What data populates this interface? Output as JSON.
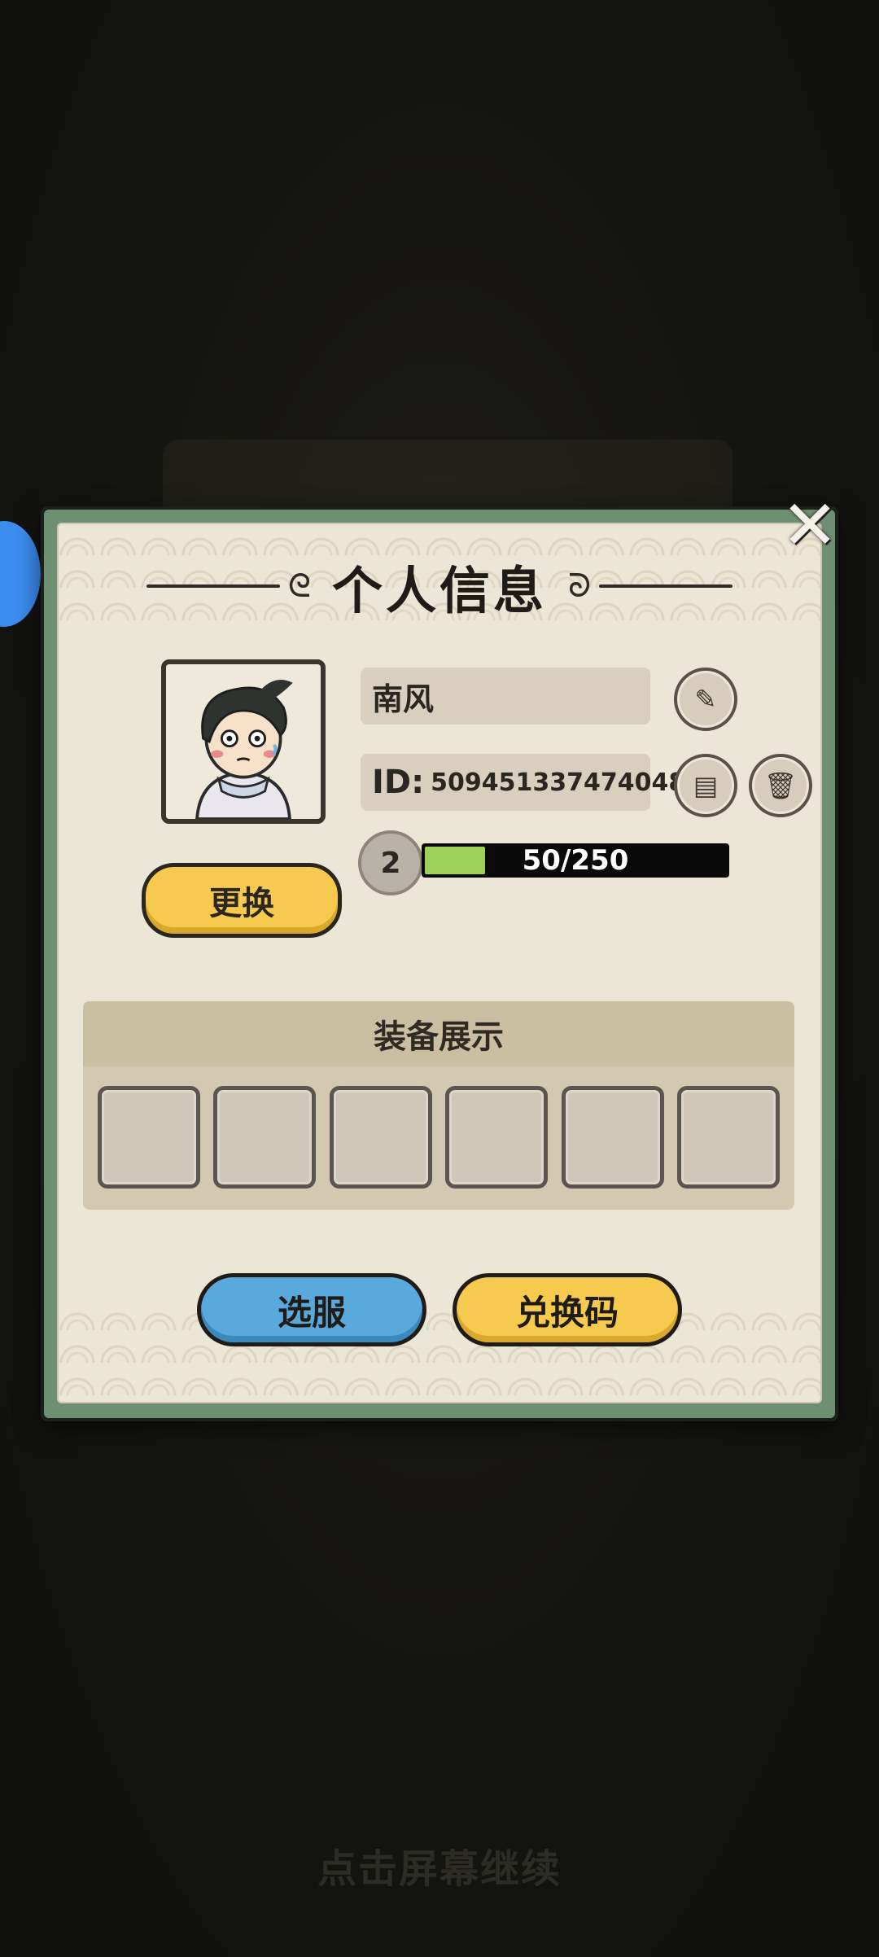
{
  "dialog": {
    "title": "个人信息",
    "close_icon": "close-icon"
  },
  "profile": {
    "name": "南风",
    "id_label": "ID:",
    "id_value": "509451337474048",
    "change_avatar_label": "更换",
    "level": "2",
    "xp_text": "50/250",
    "xp_fraction": 0.2,
    "icons": {
      "edit": "brush-icon",
      "copy": "copy-icon",
      "delete": "trash-icon"
    }
  },
  "equipment": {
    "title": "装备展示",
    "slots": [
      "",
      "",
      "",
      "",
      "",
      ""
    ]
  },
  "actions": {
    "select_server_label": "选服",
    "redeem_code_label": "兑换码"
  },
  "footer": {
    "hint": "点击屏幕继续"
  },
  "colors": {
    "panel_border": "#6f8f72",
    "parchment": "#ece6d6",
    "yellow_button": "#f6c94f",
    "blue_button": "#5aa9dc",
    "xp_fill": "#9ed15a"
  }
}
